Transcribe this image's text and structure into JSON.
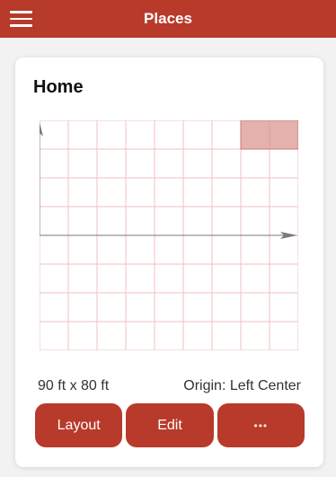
{
  "app": {
    "title": "Places",
    "accent": "#b83a2a"
  },
  "header": {
    "menu_icon": "hamburger-menu-icon"
  },
  "place": {
    "name": "Home",
    "dimensions": "90 ft x 80 ft",
    "origin": "Origin: Left Center",
    "highlight_color": "#d9908a",
    "grid_color": "#f0c2bf"
  },
  "actions": {
    "layout_label": "Layout",
    "edit_label": "Edit",
    "more_label": "•••",
    "more_icon": "more-dots-icon"
  }
}
